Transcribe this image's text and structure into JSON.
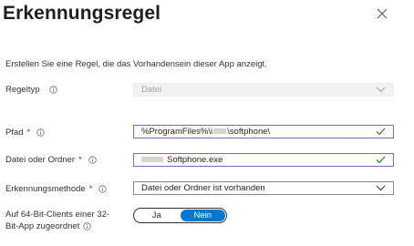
{
  "panel": {
    "title": "Erkennungsregel",
    "intro": "Erstellen Sie eine Regel, die das Vorhandensein dieser App anzeigt."
  },
  "rule_type": {
    "label": "Regeltyp",
    "value": "Datei"
  },
  "path": {
    "label": "Pfad",
    "required_mark": "*",
    "value_prefix": "%ProgramFiles%\\i",
    "value_suffix": "\\softphone\\"
  },
  "file_or_folder": {
    "label": "Datei oder Ordner",
    "required_mark": "*",
    "value": "Softphone.exe"
  },
  "detection_method": {
    "label": "Erkennungsmethode",
    "required_mark": "*",
    "value": "Datei oder Ordner ist vorhanden"
  },
  "bitness": {
    "label_line1": "Auf 64-Bit-Clients einer 32-",
    "label_line2": "Bit-App zugeordnet",
    "option_yes": "Ja",
    "option_no": "Nein",
    "selected": "Nein"
  },
  "colors": {
    "accent": "#0078d4",
    "valid_border": "#8764b8",
    "checkmark": "#107c10",
    "required": "#a4262c"
  }
}
